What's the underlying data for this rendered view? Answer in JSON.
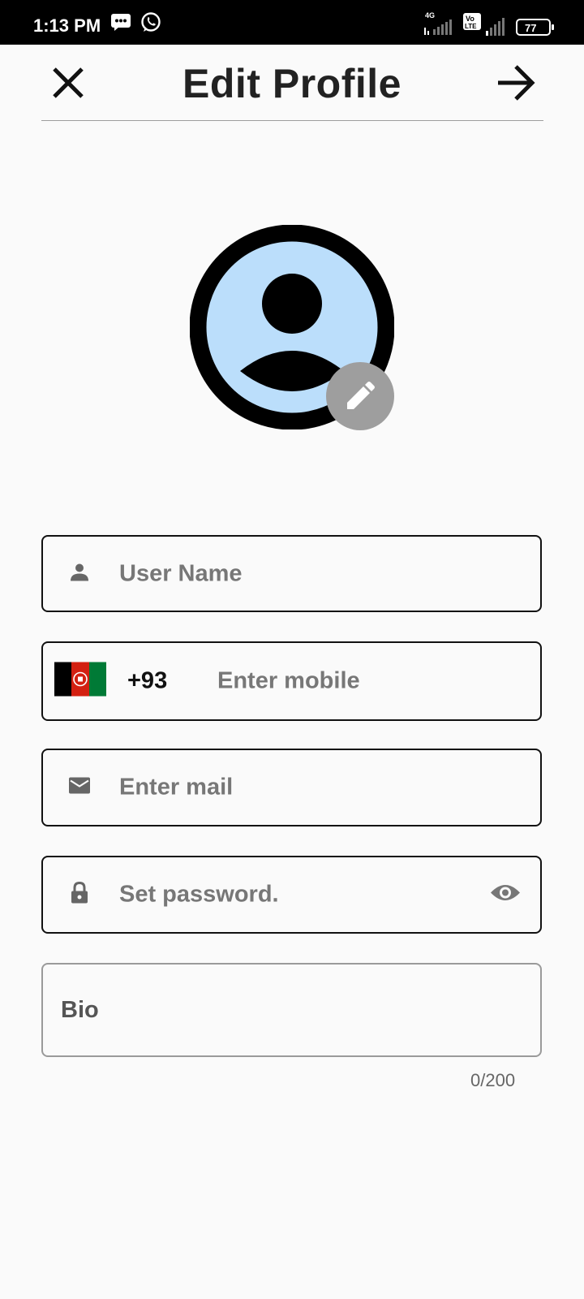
{
  "status_bar": {
    "time": "1:13 PM",
    "battery": "77",
    "network": "4G",
    "volte": "Vo LTE"
  },
  "header": {
    "title": "Edit Profile"
  },
  "form": {
    "username_placeholder": "User Name",
    "country_code": "+93",
    "mobile_placeholder": "Enter mobile",
    "email_placeholder": "Enter mail",
    "password_placeholder": "Set password.",
    "bio_label": "Bio",
    "bio_counter": "0/200"
  },
  "icons": {
    "close": "close-icon",
    "next": "arrow-forward-icon",
    "avatar": "account-circle-icon",
    "edit": "pencil-icon",
    "user": "person-icon",
    "flag": "afghanistan-flag-icon",
    "mail": "mail-icon",
    "lock": "lock-icon",
    "visibility": "eye-icon"
  },
  "colors": {
    "avatar_fill": "#bbdefb",
    "edit_badge": "#9e9e9e",
    "placeholder": "#777777",
    "background": "#fafafa"
  }
}
